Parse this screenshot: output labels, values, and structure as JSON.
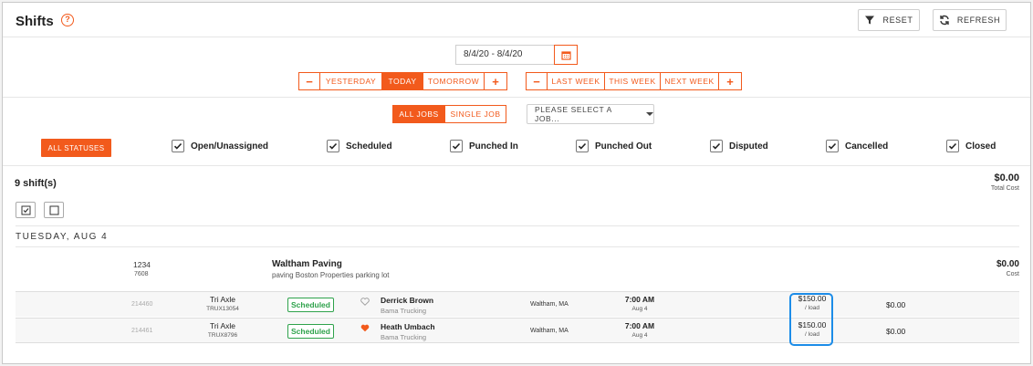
{
  "header": {
    "title": "Shifts",
    "help_icon": "question-circle-icon",
    "reset_label": "RESET",
    "refresh_label": "REFRESH"
  },
  "date_filter": {
    "range_value": "8/4/20  -  8/4/20",
    "day_nav": {
      "minus": "−",
      "items": [
        "YESTERDAY",
        "TODAY",
        "TOMORROW"
      ],
      "plus": "+",
      "selected": "TODAY"
    },
    "week_nav": {
      "minus": "−",
      "items": [
        "LAST WEEK",
        "THIS WEEK",
        "NEXT WEEK"
      ],
      "plus": "+"
    }
  },
  "job_filter": {
    "all_jobs": "ALL JOBS",
    "single_job": "SINGLE JOB",
    "select_placeholder": "PLEASE SELECT A JOB..."
  },
  "status_filter": {
    "all_label": "ALL STATUSES",
    "items": [
      "Open/Unassigned",
      "Scheduled",
      "Punched In",
      "Punched Out",
      "Disputed",
      "Cancelled",
      "Closed"
    ]
  },
  "summary": {
    "count": "9 shift(s)",
    "total_cost": "$0.00",
    "total_cost_label": "Total Cost"
  },
  "day_header": "TUESDAY, AUG 4",
  "group": {
    "id": "1234",
    "sub_id": "7608",
    "name": "Waltham Paving",
    "desc": "paving Boston Properties parking lot",
    "cost": "$0.00",
    "cost_label": "Cost"
  },
  "rows": [
    {
      "id": "214460",
      "truck": "Tri Axle",
      "truck_id": "TRUX13054",
      "status": "Scheduled",
      "favorite": false,
      "driver": "Derrick Brown",
      "company": "Bama Trucking",
      "location": "Waltham, MA",
      "time": "7:00 AM",
      "date": "Aug 4",
      "rate": "$150.00",
      "rate_unit": "/ load",
      "cost": "$0.00"
    },
    {
      "id": "214461",
      "truck": "Tri Axle",
      "truck_id": "TRUX8796",
      "status": "Scheduled",
      "favorite": true,
      "driver": "Heath Umbach",
      "company": "Bama Trucking",
      "location": "Waltham, MA",
      "time": "7:00 AM",
      "date": "Aug 4",
      "rate": "$150.00",
      "rate_unit": "/ load",
      "cost": "$0.00"
    }
  ],
  "colors": {
    "accent": "#f25a1c",
    "status_green": "#2ea24b",
    "highlight_blue": "#1c8ce8"
  }
}
